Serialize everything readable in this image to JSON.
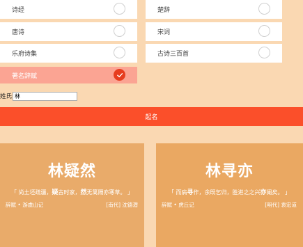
{
  "options": [
    {
      "label": "诗经",
      "selected": false
    },
    {
      "label": "楚辞",
      "selected": false
    },
    {
      "label": "唐诗",
      "selected": false
    },
    {
      "label": "宋词",
      "selected": false
    },
    {
      "label": "乐府诗集",
      "selected": false
    },
    {
      "label": "古诗三百首",
      "selected": false
    },
    {
      "label": "著名辞赋",
      "selected": true
    }
  ],
  "surname": {
    "label": "姓氏",
    "value": "林"
  },
  "generate_label": "起名",
  "results": [
    {
      "name": "林疑然",
      "quote_pre": "「 尚土坯疏疆，",
      "quote_h1": "疑",
      "quote_mid": "古时家，",
      "quote_h2": "然",
      "quote_post": "无篱隔亦寒草。 」",
      "source": "辞赋 • 游虞山记",
      "author": "[南代] 沈德潜"
    },
    {
      "name": "林寻亦",
      "quote_pre": "「 而病",
      "quote_h1": "寻",
      "quote_mid": "作，余既乞归，胜进之之兴",
      "quote_h2": "亦",
      "quote_post": "阑矣。 」",
      "source": "辞赋 • 虎丘记",
      "author": "[明代] 袁宏道"
    }
  ],
  "colors": {
    "background": "#fad8b2",
    "card": "#e9ab6a",
    "accent": "#fb4f2a",
    "selected_option": "#fba493",
    "selected_radio": "#e73d1f"
  }
}
